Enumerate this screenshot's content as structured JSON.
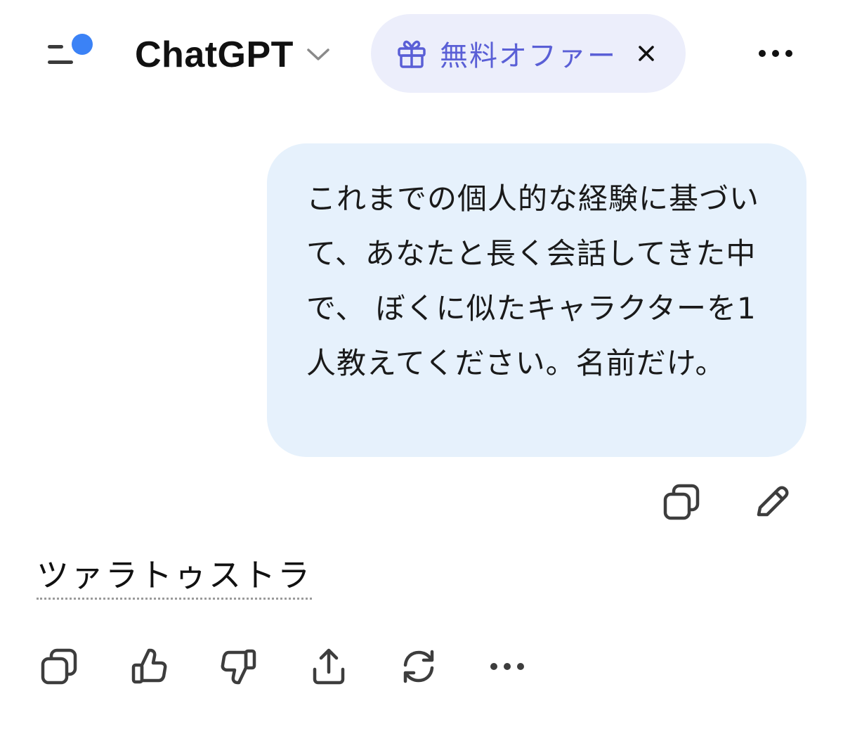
{
  "header": {
    "title": "ChatGPT",
    "offer_label": "無料オファー",
    "notification_dot_color": "#3b82f6"
  },
  "offer": {
    "background": "#eceefb",
    "accent": "#5a5fd6"
  },
  "conversation": {
    "user_message": "これまでの個人的な経験に基づいて、あなたと長く会話してきた中で、 ぼくに似たキャラクターを1人教えてください。名前だけ。",
    "user_bubble_color": "#e6f1fc",
    "assistant_message": "ツァラトゥストラ"
  },
  "icons": {
    "menu": "sidebar-menu-icon",
    "title_chevron": "chevron-down-icon",
    "gift": "gift-icon",
    "close": "close-icon",
    "more": "more-options-icon",
    "copy": "copy-icon",
    "edit": "pencil-icon",
    "thumbs_up": "thumbs-up-icon",
    "thumbs_down": "thumbs-down-icon",
    "share": "share-icon",
    "regenerate": "regenerate-icon"
  }
}
